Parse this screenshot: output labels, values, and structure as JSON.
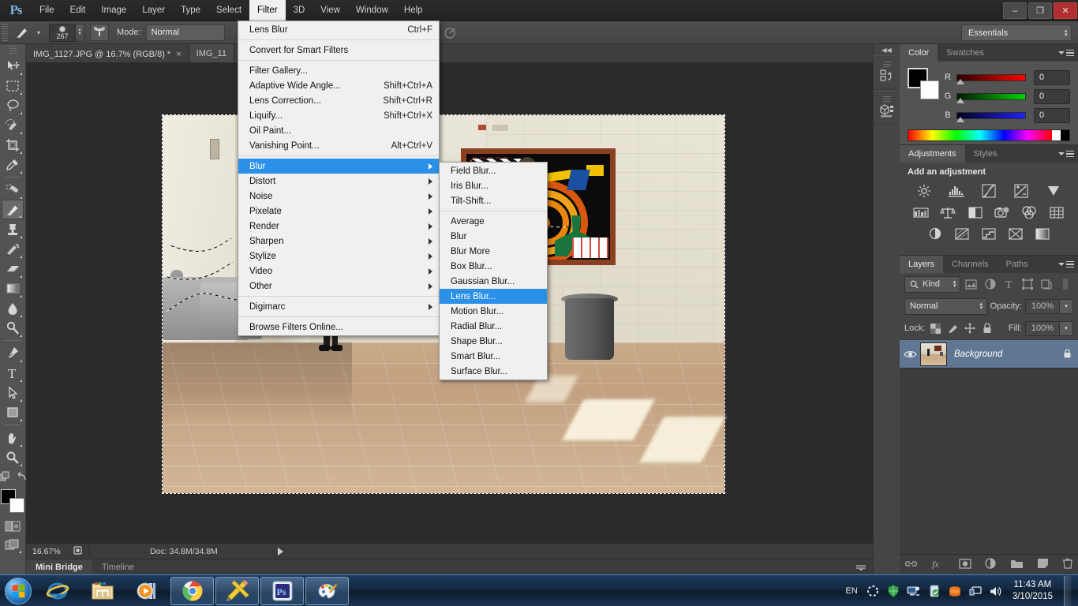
{
  "app": {
    "name": "Adobe Photoshop",
    "logo": "Ps",
    "window_buttons": {
      "minimize": "–",
      "restore": "❐",
      "close": "✕"
    }
  },
  "menubar": {
    "items": [
      {
        "label": "File"
      },
      {
        "label": "Edit"
      },
      {
        "label": "Image"
      },
      {
        "label": "Layer"
      },
      {
        "label": "Type"
      },
      {
        "label": "Select"
      },
      {
        "label": "Filter",
        "active": true
      },
      {
        "label": "3D"
      },
      {
        "label": "View"
      },
      {
        "label": "Window"
      },
      {
        "label": "Help"
      }
    ]
  },
  "options_bar": {
    "brush_size": "267",
    "mode_label": "Mode:",
    "mode_value": "Normal",
    "workspace": "Essentials"
  },
  "document_tabs": [
    {
      "title": "IMG_1127.JPG @ 16.7% (RGB/8) *",
      "close": "×",
      "active": true
    },
    {
      "title": "IMG_11",
      "active": false
    }
  ],
  "filter_menu": {
    "items": [
      {
        "label": "Lens Blur",
        "accel": "Ctrl+F"
      },
      {
        "separator": true
      },
      {
        "label": "Convert for Smart Filters"
      },
      {
        "separator": true
      },
      {
        "label": "Filter Gallery..."
      },
      {
        "label": "Adaptive Wide Angle...",
        "accel": "Shift+Ctrl+A"
      },
      {
        "label": "Lens Correction...",
        "accel": "Shift+Ctrl+R"
      },
      {
        "label": "Liquify...",
        "accel": "Shift+Ctrl+X"
      },
      {
        "label": "Oil Paint..."
      },
      {
        "label": "Vanishing Point...",
        "accel": "Alt+Ctrl+V"
      },
      {
        "separator": true
      },
      {
        "label": "Blur",
        "submenu": true,
        "highlighted": true
      },
      {
        "label": "Distort",
        "submenu": true
      },
      {
        "label": "Noise",
        "submenu": true
      },
      {
        "label": "Pixelate",
        "submenu": true
      },
      {
        "label": "Render",
        "submenu": true
      },
      {
        "label": "Sharpen",
        "submenu": true
      },
      {
        "label": "Stylize",
        "submenu": true
      },
      {
        "label": "Video",
        "submenu": true
      },
      {
        "label": "Other",
        "submenu": true
      },
      {
        "separator": true
      },
      {
        "label": "Digimarc",
        "submenu": true
      },
      {
        "separator": true
      },
      {
        "label": "Browse Filters Online..."
      }
    ]
  },
  "blur_submenu": {
    "items": [
      {
        "label": "Field Blur..."
      },
      {
        "label": "Iris Blur..."
      },
      {
        "label": "Tilt-Shift..."
      },
      {
        "separator": true
      },
      {
        "label": "Average"
      },
      {
        "label": "Blur"
      },
      {
        "label": "Blur More"
      },
      {
        "label": "Box Blur..."
      },
      {
        "label": "Gaussian Blur..."
      },
      {
        "label": "Lens Blur...",
        "highlighted": true
      },
      {
        "label": "Motion Blur..."
      },
      {
        "label": "Radial Blur..."
      },
      {
        "label": "Shape Blur..."
      },
      {
        "label": "Smart Blur..."
      },
      {
        "label": "Surface Blur..."
      }
    ]
  },
  "status_bar": {
    "zoom": "16.67%",
    "doc": "Doc: 34.8M/34.8M"
  },
  "bottom_tabs": [
    {
      "label": "Mini Bridge",
      "active": true
    },
    {
      "label": "Timeline",
      "active": false
    }
  ],
  "panels": {
    "color": {
      "tabs": [
        {
          "label": "Color",
          "active": true
        },
        {
          "label": "Swatches",
          "active": false
        }
      ],
      "channels": [
        {
          "name": "R",
          "value": "0",
          "color": "#ff0000"
        },
        {
          "name": "G",
          "value": "0",
          "color": "#00cc00"
        },
        {
          "name": "B",
          "value": "0",
          "color": "#0000ff"
        }
      ]
    },
    "adjustments": {
      "tabs": [
        {
          "label": "Adjustments",
          "active": true
        },
        {
          "label": "Styles",
          "active": false
        }
      ],
      "title": "Add an adjustment",
      "row1": [
        "brightness-contrast-icon",
        "levels-icon",
        "curves-icon",
        "exposure-icon",
        "vibrance-icon"
      ],
      "row2": [
        "hue-saturation-icon",
        "color-balance-icon",
        "black-white-icon",
        "photo-filter-icon",
        "channel-mixer-icon",
        "color-lookup-icon"
      ],
      "row3": [
        "invert-icon",
        "posterize-icon",
        "threshold-icon",
        "gradient-map-icon",
        "selective-color-icon"
      ]
    },
    "layers": {
      "tabs": [
        {
          "label": "Layers",
          "active": true
        },
        {
          "label": "Channels",
          "active": false
        },
        {
          "label": "Paths",
          "active": false
        }
      ],
      "filter_kind": "Kind",
      "blend_mode": "Normal",
      "opacity_label": "Opacity:",
      "opacity_value": "100%",
      "lock_label": "Lock:",
      "fill_label": "Fill:",
      "fill_value": "100%",
      "rows": [
        {
          "name": "Background",
          "locked": true,
          "visible": true
        }
      ]
    }
  },
  "toolbar": {
    "tools": [
      {
        "name": "move-tool"
      },
      {
        "name": "rectangular-marquee-tool"
      },
      {
        "name": "lasso-tool"
      },
      {
        "name": "quick-selection-tool"
      },
      {
        "name": "crop-tool"
      },
      {
        "name": "eyedropper-tool"
      },
      {
        "name": "spot-healing-brush-tool"
      },
      {
        "name": "brush-tool",
        "selected": true
      },
      {
        "name": "clone-stamp-tool"
      },
      {
        "name": "history-brush-tool"
      },
      {
        "name": "eraser-tool"
      },
      {
        "name": "gradient-tool"
      },
      {
        "name": "blur-tool"
      },
      {
        "name": "dodge-tool"
      },
      {
        "name": "pen-tool"
      },
      {
        "name": "type-tool"
      },
      {
        "name": "path-selection-tool"
      },
      {
        "name": "rectangle-tool"
      },
      {
        "name": "hand-tool"
      },
      {
        "name": "zoom-tool"
      }
    ]
  },
  "taskbar": {
    "buttons": [
      {
        "name": "internet-explorer-icon",
        "open": false
      },
      {
        "name": "file-explorer-icon",
        "open": false
      },
      {
        "name": "windows-media-player-icon",
        "open": false
      },
      {
        "name": "google-chrome-icon",
        "open": true
      },
      {
        "name": "notepad-pencil-icon",
        "open": true
      },
      {
        "name": "photoshop-icon",
        "open": true
      },
      {
        "name": "paint-icon",
        "open": true
      }
    ],
    "tray": {
      "language": "EN",
      "icons": [
        "action-center-icon",
        "security-shield-icon",
        "network-icon",
        "battery-icon",
        "update-icon",
        "display-icon",
        "volume-icon"
      ],
      "time": "11:43 AM",
      "date": "3/10/2015"
    }
  }
}
